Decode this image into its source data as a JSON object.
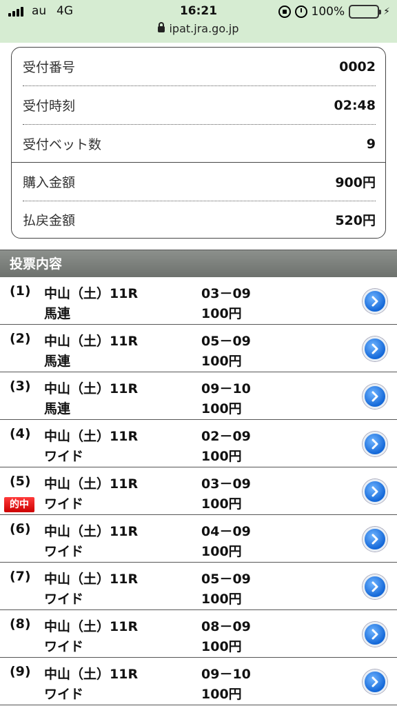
{
  "status_bar": {
    "carrier": "au",
    "network": "4G",
    "time": "16:21",
    "battery": "100%",
    "url": "ipat.jra.go.jp"
  },
  "summary": {
    "receipt_number_label": "受付番号",
    "receipt_number": "0002",
    "receipt_time_label": "受付時刻",
    "receipt_time": "02:48",
    "bet_count_label": "受付ベット数",
    "bet_count": "9",
    "purchase_amount_label": "購入金額",
    "purchase_amount": "900円",
    "payout_amount_label": "払戻金額",
    "payout_amount": "520円"
  },
  "section_title": "投票内容",
  "hit_badge_label": "的中",
  "bets": [
    {
      "num": "(1)",
      "race": "中山（土）11R",
      "type": "馬連",
      "combo": "03－09",
      "amount": "100円",
      "hit": false
    },
    {
      "num": "(2)",
      "race": "中山（土）11R",
      "type": "馬連",
      "combo": "05－09",
      "amount": "100円",
      "hit": false
    },
    {
      "num": "(3)",
      "race": "中山（土）11R",
      "type": "馬連",
      "combo": "09－10",
      "amount": "100円",
      "hit": false
    },
    {
      "num": "(4)",
      "race": "中山（土）11R",
      "type": "ワイド",
      "combo": "02－09",
      "amount": "100円",
      "hit": false
    },
    {
      "num": "(5)",
      "race": "中山（土）11R",
      "type": "ワイド",
      "combo": "03－09",
      "amount": "100円",
      "hit": true
    },
    {
      "num": "(6)",
      "race": "中山（土）11R",
      "type": "ワイド",
      "combo": "04－09",
      "amount": "100円",
      "hit": false
    },
    {
      "num": "(7)",
      "race": "中山（土）11R",
      "type": "ワイド",
      "combo": "05－09",
      "amount": "100円",
      "hit": false
    },
    {
      "num": "(8)",
      "race": "中山（土）11R",
      "type": "ワイド",
      "combo": "08－09",
      "amount": "100円",
      "hit": false
    },
    {
      "num": "(9)",
      "race": "中山（土）11R",
      "type": "ワイド",
      "combo": "09－10",
      "amount": "100円",
      "hit": false
    }
  ],
  "colors": {
    "status_bg": "#d6ecd2",
    "section_bg": "#7a7e7a",
    "hit_badge": "#e00000",
    "nav_button": "#1468d8"
  },
  "icons": {
    "row_action": "chevron-right-circle-icon",
    "hit": "hit-badge"
  }
}
